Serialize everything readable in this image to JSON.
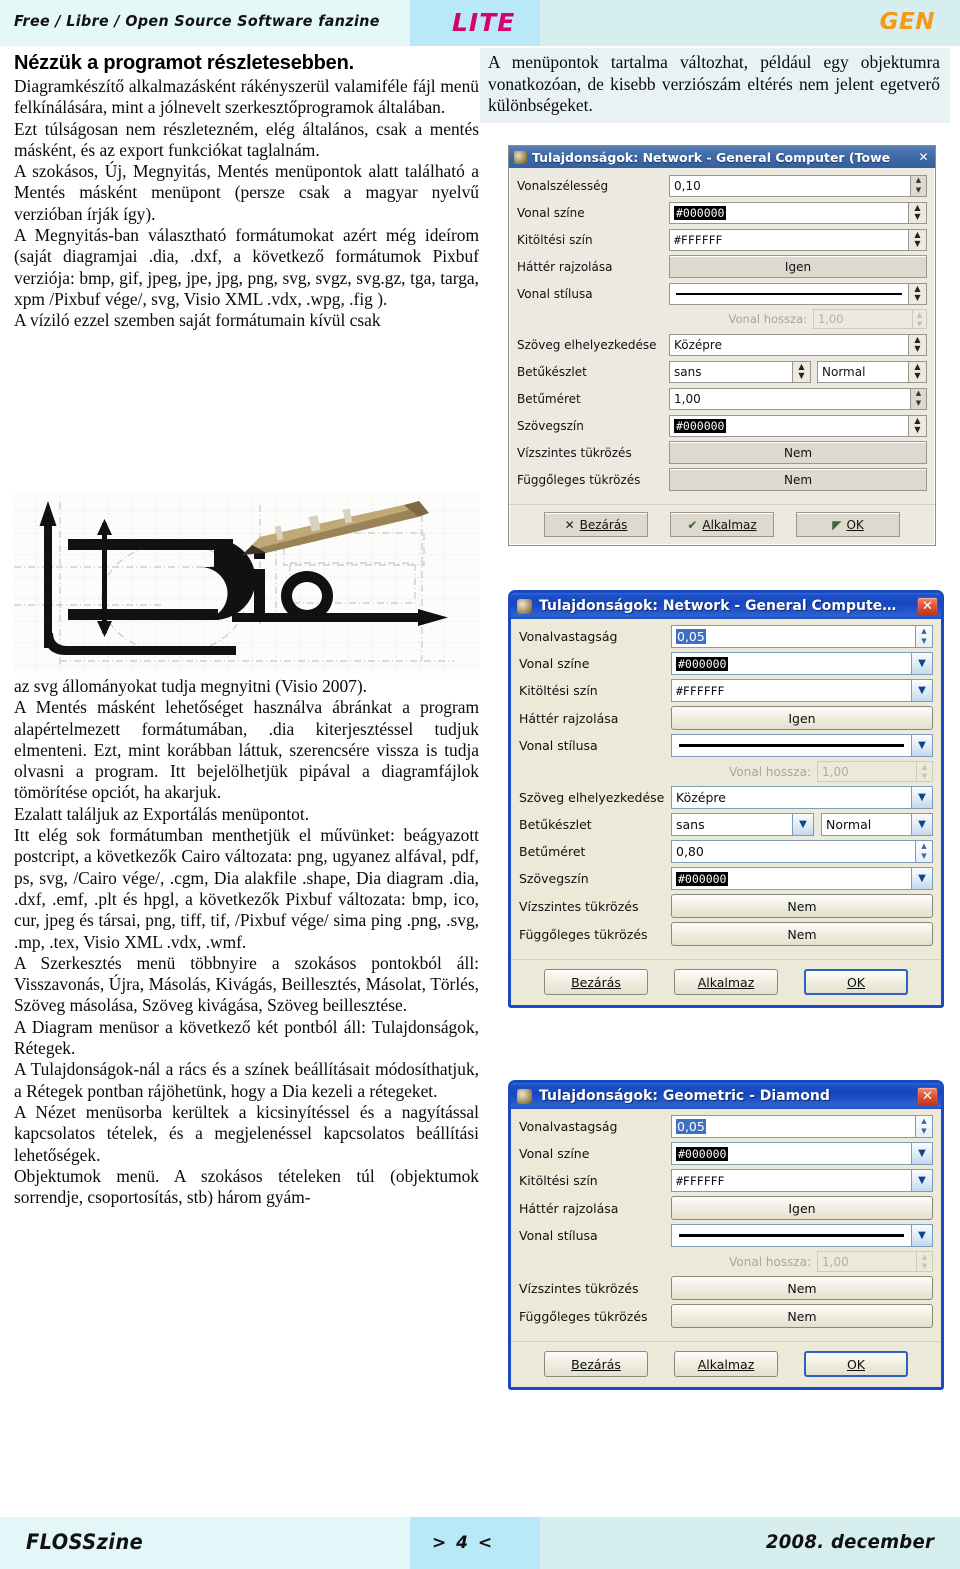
{
  "masthead": {
    "tagline": "Free / Libre / Open Source Software fanzine",
    "lite": "LITE",
    "gen": "GEN",
    "lite_color": "#d6006e",
    "gen_color": "#f49a1a"
  },
  "footer": {
    "brand": "FLOSSzine",
    "pager": "> 4 <",
    "date": "2008. december"
  },
  "intro": {
    "text": "A menüpontok tartalma változhat, például egy objektumra vonatkozóan, de kisebb verziószám eltérés nem jelent egetverő különbségeket."
  },
  "article": {
    "heading": "Nézzük a programot részletesebben.",
    "paragraphs": [
      "Diagramkészítő alkalmazásként rákényszerül valamiféle fájl menü felkínálására, mint a jólnevelt szerkesztőprogramok általában.",
      "Ezt túlságosan nem részletezném, elég általános, csak a mentés másként, és az export funkciókat taglalnám.",
      "A szokásos, Új, Megnyitás, Mentés menüpontok alatt található a Mentés másként menüpont (persze csak a magyar nyelvű verzióban írják így).",
      "A Megnyitás-ban választható formátumokat azért még ideírom (saját diagramjai .dia, .dxf, a következő formátumok Pixbuf verziója: bmp, gif, jpeg, jpe, jpg, png, svg, svgz, svg.gz, tga, targa, xpm /Pixbuf vége/, svg, Visio XML .vdx, .wpg, .fig ).",
      "A víziló ezzel szemben saját formátumain kívül csak"
    ],
    "paragraphs_after_logo": [
      "az svg állományokat tudja megnyitni (Visio 2007).",
      "A Mentés másként lehetőséget használva ábránkat a program alapértelmezett formátumában, .dia kiterjesztéssel tudjuk elmenteni. Ezt, mint korábban láttuk, szerencsére vissza is tudja olvasni a program. Itt bejelölhetjük pipával a diagramfájlok tömörítése opciót, ha akarjuk.",
      "Ezalatt találjuk az Exportálás menüpontot.",
      "Itt elég sok formátumban menthetjük el művünket: beágyazott postcript, a következők Cairo változata: png, ugyanez alfával, pdf, ps, svg, /Cairo vége/, .cgm, Dia alakfile .shape, Dia diagram .dia, .dxf, .emf, .plt és hpgl, a következők Pixbuf változata: bmp, ico, cur, jpeg és társai, png, tiff, tif, /Pixbuf vége/ sima ping .png, .svg, .mp, .tex, Visio XML .vdx, .wmf.",
      "A Szerkesztés menü többnyire a szokásos pontokból áll: Visszavonás, Újra, Másolás, Kivágás, Beillesztés, Másolat, Törlés, Szöveg másolása, Szöveg kivágása, Szöveg beillesztése.",
      "A Diagram menüsor a következő két pontból áll: Tulajdonságok, Rétegek.",
      "A Tulajdonságok-nál a rács és a színek beállításait módosíthatjuk, a Rétegek pontban rájöhetünk, hogy a Dia kezeli a rétegeket.",
      "A Nézet menüsorba kerültek a kicsinyítéssel és a nagyítással kapcsolatos tételek, és a megjelenéssel kapcsolatos beállítási lehetőségek.",
      "Objektumok menü. A szokásos tételeken túl (objektumok sorrendje, csoportosítás, stb) három gyám-"
    ]
  },
  "logo": {
    "alt": "Dia logo with pen on graph paper",
    "wordmark": "Dia"
  },
  "dialog1": {
    "style": "gtk",
    "title": "Tulajdonságok: Network - General Computer (Towe",
    "close_label": "✕",
    "fields": [
      {
        "label": "Vonalszélesség",
        "value": "0,10",
        "widget": "spin"
      },
      {
        "label": "Vonal színe",
        "value": "#000000",
        "widget": "color",
        "selected": true
      },
      {
        "label": "Kitöltési szín",
        "value": "#FFFFFF",
        "widget": "color",
        "selected": false
      },
      {
        "label": "Háttér rajzolása",
        "value": "Igen",
        "widget": "button"
      },
      {
        "label": "Vonal stílusa",
        "value": "",
        "widget": "linestyle"
      }
    ],
    "line_length_label": "Vonal hossza:",
    "line_length_value": "1,00",
    "fields2": [
      {
        "label": "Szöveg elhelyezkedése",
        "value": "Középre",
        "widget": "combo"
      },
      {
        "label": "Betűkészlet",
        "value": "sans",
        "value2": "Normal",
        "widget": "fontcombo"
      },
      {
        "label": "Betűméret",
        "value": "1,00",
        "widget": "spin"
      },
      {
        "label": "Szövegszín",
        "value": "#000000",
        "widget": "color",
        "selected": true
      },
      {
        "label": "Vízszintes tükrözés",
        "value": "Nem",
        "widget": "button"
      },
      {
        "label": "Függőleges tükrözés",
        "value": "Nem",
        "widget": "button"
      }
    ],
    "buttons": [
      {
        "label": "Bezárás",
        "icon": "close-x-icon",
        "accel": "B"
      },
      {
        "label": "Alkalmaz",
        "icon": "check-icon",
        "accel": "A"
      },
      {
        "label": "OK",
        "icon": "ok-icon",
        "accel": "O",
        "default": true
      }
    ]
  },
  "dialog2": {
    "style": "xp",
    "title": "Tulajdonságok: Network - General Compute…",
    "close_label": "✕",
    "fields": [
      {
        "label": "Vonalvastagság",
        "value": "0,05",
        "widget": "spin",
        "selected": true
      },
      {
        "label": "Vonal színe",
        "value": "#000000",
        "widget": "color",
        "selected": true
      },
      {
        "label": "Kitöltési szín",
        "value": "#FFFFFF",
        "widget": "color",
        "selected": false
      },
      {
        "label": "Háttér rajzolása",
        "value": "Igen",
        "widget": "button"
      },
      {
        "label": "Vonal stílusa",
        "value": "",
        "widget": "linestyle"
      }
    ],
    "line_length_label": "Vonal hossza:",
    "line_length_value": "1,00",
    "fields2": [
      {
        "label": "Szöveg elhelyezkedése",
        "value": "Középre",
        "widget": "combo"
      },
      {
        "label": "Betűkészlet",
        "value": "sans",
        "value2": "Normal",
        "widget": "fontcombo"
      },
      {
        "label": "Betűméret",
        "value": "0,80",
        "widget": "spin"
      },
      {
        "label": "Szövegszín",
        "value": "#000000",
        "widget": "color",
        "selected": true
      },
      {
        "label": "Vízszintes tükrözés",
        "value": "Nem",
        "widget": "button"
      },
      {
        "label": "Függőleges tükrözés",
        "value": "Nem",
        "widget": "button"
      }
    ],
    "buttons": [
      {
        "label": "Bezárás",
        "accel": "B"
      },
      {
        "label": "Alkalmaz",
        "accel": "A"
      },
      {
        "label": "OK",
        "accel": "O",
        "default": true
      }
    ]
  },
  "dialog3": {
    "style": "xp",
    "title": "Tulajdonságok: Geometric - Diamond",
    "close_label": "✕",
    "fields": [
      {
        "label": "Vonalvastagság",
        "value": "0,05",
        "widget": "spin",
        "selected": true
      },
      {
        "label": "Vonal színe",
        "value": "#000000",
        "widget": "color",
        "selected": true
      },
      {
        "label": "Kitöltési szín",
        "value": "#FFFFFF",
        "widget": "color",
        "selected": false
      },
      {
        "label": "Háttér rajzolása",
        "value": "Igen",
        "widget": "button"
      },
      {
        "label": "Vonal stílusa",
        "value": "",
        "widget": "linestyle"
      }
    ],
    "line_length_label": "Vonal hossza:",
    "line_length_value": "1,00",
    "fields2": [
      {
        "label": "Vízszintes tükrözés",
        "value": "Nem",
        "widget": "button"
      },
      {
        "label": "Függőleges tükrözés",
        "value": "Nem",
        "widget": "button"
      }
    ],
    "buttons": [
      {
        "label": "Bezárás",
        "accel": "B"
      },
      {
        "label": "Alkalmaz",
        "accel": "A"
      },
      {
        "label": "OK",
        "accel": "O",
        "default": true
      }
    ]
  }
}
